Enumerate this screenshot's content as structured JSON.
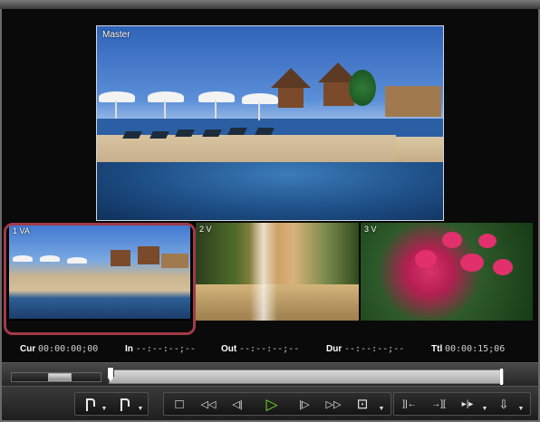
{
  "viewer": {
    "master_label": "Master"
  },
  "cameras": [
    {
      "label": "1 VA"
    },
    {
      "label": "2 V"
    },
    {
      "label": "3 V"
    }
  ],
  "timecodes": {
    "cur": {
      "key": "Cur",
      "value": "00:00:00;00"
    },
    "in": {
      "key": "In",
      "value": "--:--:--;--"
    },
    "out": {
      "key": "Out",
      "value": "--:--:--;--"
    },
    "dur": {
      "key": "Dur",
      "value": "--:--:--;--"
    },
    "ttl": {
      "key": "Ttl",
      "value": "00:00:15;06"
    }
  },
  "colors": {
    "play_accent": "#6fdc2a",
    "selection_border": "#a23a48"
  },
  "toolbar": {
    "buttons": [
      {
        "name": "set-in-icon"
      },
      {
        "name": "set-out-icon"
      },
      {
        "name": "stop-icon",
        "glyph": "□"
      },
      {
        "name": "rewind-icon",
        "glyph": "◁◁"
      },
      {
        "name": "step-back-icon",
        "glyph": "◁|"
      },
      {
        "name": "play-icon",
        "glyph": "▷"
      },
      {
        "name": "step-forward-icon",
        "glyph": "|▷"
      },
      {
        "name": "fast-forward-icon",
        "glyph": "▷▷"
      },
      {
        "name": "loop-icon",
        "glyph": "⊡"
      },
      {
        "name": "go-to-in-icon",
        "glyph": "]|←"
      },
      {
        "name": "go-to-prev-edit-icon",
        "glyph": "→]["
      },
      {
        "name": "go-to-next-edit-icon",
        "glyph": "▸|▸"
      },
      {
        "name": "insert-to-timeline-icon",
        "glyph": "⇩"
      }
    ]
  }
}
